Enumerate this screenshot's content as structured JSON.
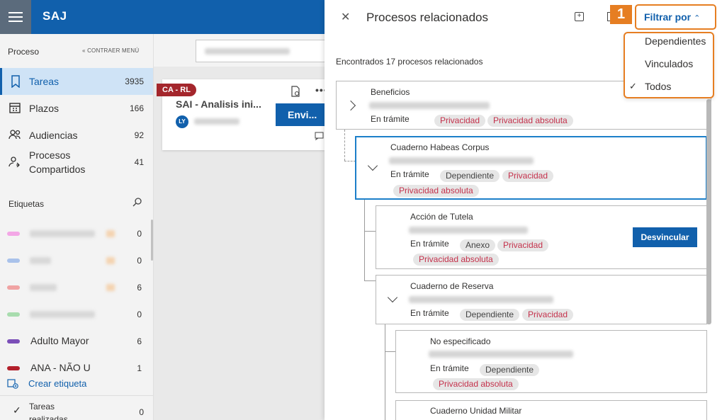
{
  "app": {
    "brand": "SAJ"
  },
  "sidebar": {
    "header": "Proceso",
    "collapse_label": "« CONTRAER MENÚ",
    "items": [
      {
        "label": "Tareas",
        "count": "3935"
      },
      {
        "label": "Plazos",
        "count": "166"
      },
      {
        "label": "Audiencias",
        "count": "92"
      },
      {
        "label": "Procesos Compartidos",
        "count": "41"
      }
    ],
    "tags_header": "Etiquetas",
    "tags": [
      {
        "color": "#f3a7e6",
        "count": "0"
      },
      {
        "color": "#a9c2ea",
        "count": "0"
      },
      {
        "color": "#f0a3a3",
        "count": "6"
      },
      {
        "color": "#a8dcae",
        "count": "0"
      },
      {
        "name": "Adulto Mayor",
        "color": "#7b4fb8",
        "count": "6"
      },
      {
        "name": "ANA - NÃO U",
        "color": "#b3202b",
        "count": "1"
      }
    ],
    "create_tag": "Crear etiqueta",
    "done": {
      "label": "Tareas realizadas",
      "count": "0"
    }
  },
  "card": {
    "ribbon": "CA - RL",
    "title": "SAI - Analisis ini...",
    "avatar": "LY",
    "send_label": "Envi..."
  },
  "panel": {
    "title": "Procesos relacionados",
    "filter_label": "Filtrar por",
    "step": "1",
    "found_text": "Encontrados 17 procesos relacionados",
    "filter_options": [
      {
        "label": "Dependientes",
        "checked": false
      },
      {
        "label": "Vinculados",
        "checked": false
      },
      {
        "label": "Todos",
        "checked": true
      }
    ],
    "unlink_label": "Desvincular",
    "nodes": [
      {
        "type": "Beneficios",
        "status": "En trámite",
        "chips": [
          "Privacidad",
          "Privacidad absoluta"
        ]
      },
      {
        "type": "Cuaderno Habeas Corpus",
        "status": "En trámite",
        "chips": [
          "Dependiente",
          "Privacidad",
          "Privacidad absoluta"
        ]
      },
      {
        "type": "Acción de Tutela",
        "status": "En trámite",
        "chips": [
          "Anexo",
          "Privacidad",
          "Privacidad absoluta"
        ]
      },
      {
        "type": "Cuaderno de Reserva",
        "status": "En trámite",
        "chips": [
          "Dependiente",
          "Privacidad"
        ]
      },
      {
        "type": "No especificado",
        "status": "En trámite",
        "chips": [
          "Dependiente",
          "Privacidad absoluta"
        ]
      },
      {
        "type": "Cuaderno Unidad Militar"
      }
    ]
  }
}
